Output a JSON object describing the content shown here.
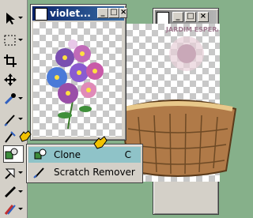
{
  "palette": {
    "canvas_bg": "#86b08a",
    "titlebar_active": "#0a246a",
    "titlebar_inactive": "#808080",
    "menu_highlight": "#8fc3c8"
  },
  "windows": {
    "front": {
      "title": "violet...",
      "buttons": [
        "_",
        "□",
        "×"
      ]
    },
    "back": {
      "buttons": [
        "_",
        "□",
        "×"
      ]
    }
  },
  "watermark": "JARDIM ESPERANÇA",
  "tool_menu": {
    "items": [
      {
        "label": "Clone",
        "shortcut": "C",
        "icon": "clone-brush-icon"
      },
      {
        "label": "Scratch Remover",
        "shortcut": "",
        "icon": "scratch-remover-icon"
      }
    ]
  },
  "toolbar": {
    "tools": [
      "pointer-icon",
      "selection-icon",
      "crop-icon",
      "move-icon",
      "dropper-icon",
      "pen-icon",
      "retouch-icon",
      "clone-tool-icon",
      "eraser-icon",
      "fill-icon",
      "color-icon"
    ]
  }
}
